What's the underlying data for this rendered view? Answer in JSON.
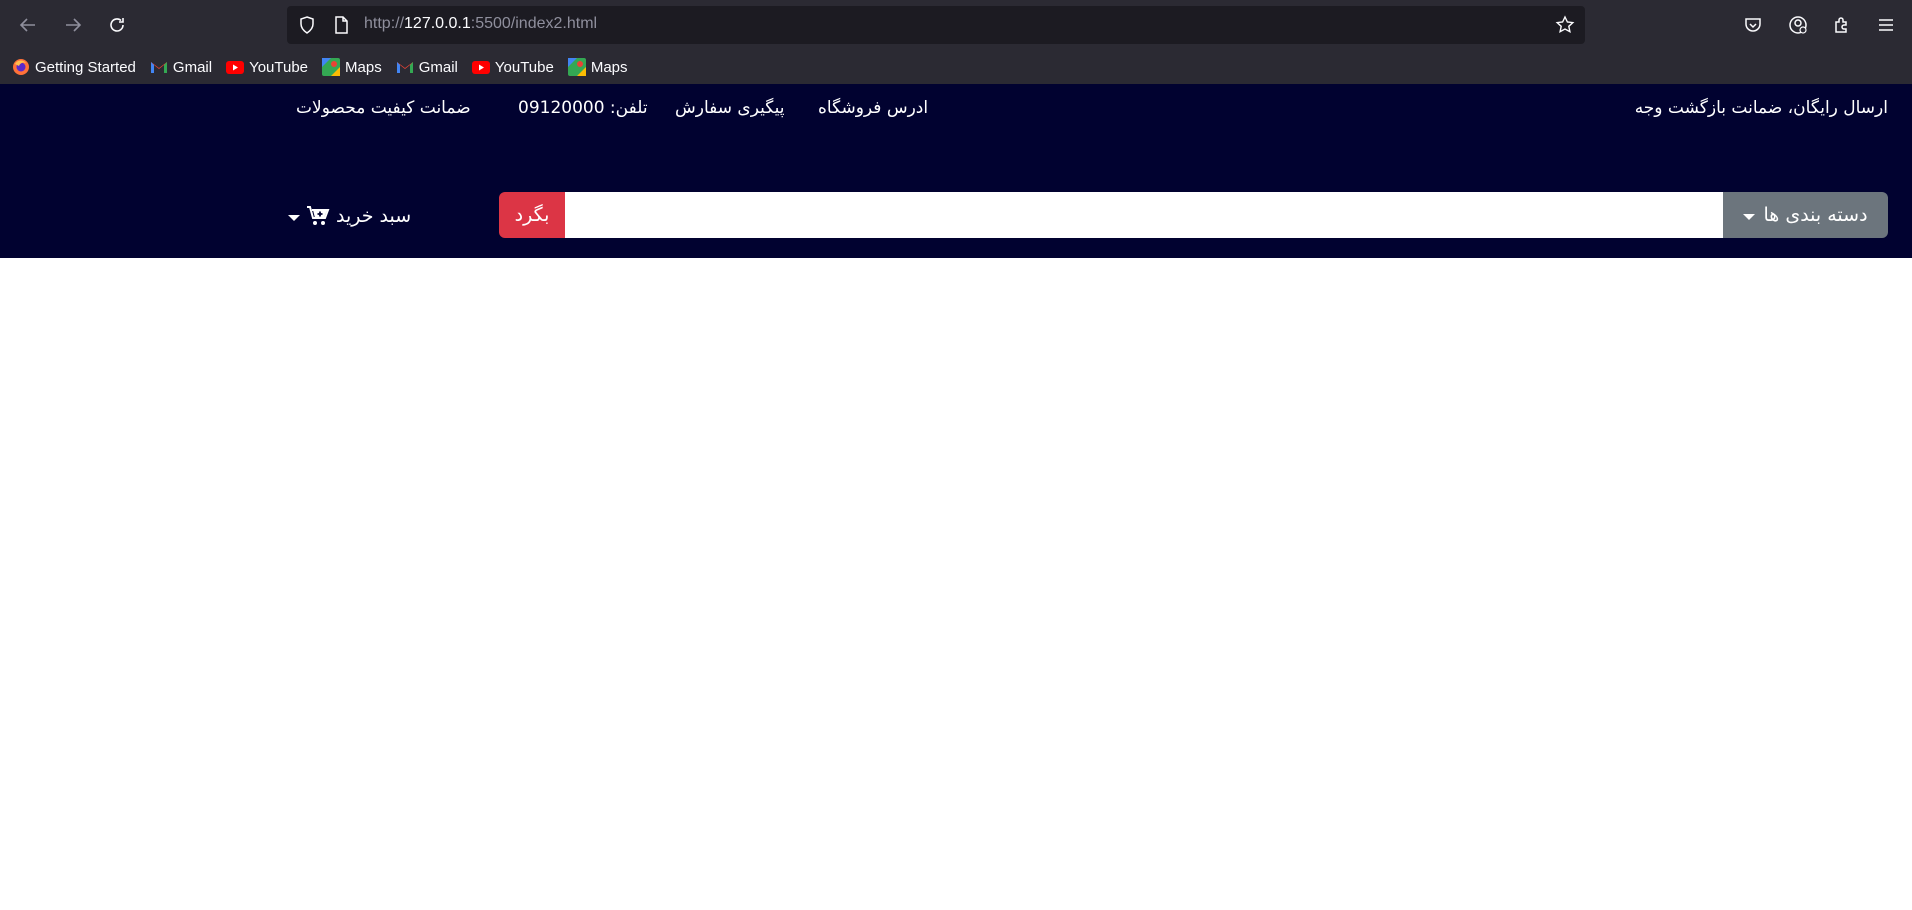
{
  "browser": {
    "url_prefix": "http://",
    "url_host": "127.0.0.1",
    "url_rest": ":5500/index2.html",
    "bookmarks": [
      {
        "label": "Getting Started",
        "icon": "firefox-icon"
      },
      {
        "label": "Gmail",
        "icon": "gmail-icon"
      },
      {
        "label": "YouTube",
        "icon": "youtube-icon"
      },
      {
        "label": "Maps",
        "icon": "maps-icon"
      },
      {
        "label": "Gmail",
        "icon": "gmail-icon"
      },
      {
        "label": "YouTube",
        "icon": "youtube-icon"
      },
      {
        "label": "Maps",
        "icon": "maps-icon"
      }
    ]
  },
  "header": {
    "promo": "ارسال رایگان، ضمانت بازگشت وجه",
    "links": {
      "store_address": "ادرس فروشگاه",
      "order_tracking": "پیگیری سفارش",
      "phone": "تلفن: 09120000",
      "quality": "ضمانت کیفیت محصولات"
    },
    "category_button": "دسته بندی ها",
    "search_placeholder": "",
    "search_button": "بگرد",
    "cart_label": "سبد خرید"
  },
  "colors": {
    "header_bg": "#010230",
    "category_bg": "#6c757d",
    "search_button_bg": "#dc3545",
    "chrome_bg": "#2b2a33"
  }
}
